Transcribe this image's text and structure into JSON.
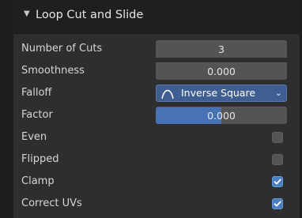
{
  "panel": {
    "title": "Loop Cut and Slide",
    "collapse_arrow": "▼"
  },
  "fields": {
    "number_of_cuts": {
      "label": "Number of Cuts",
      "value": "3"
    },
    "smoothness": {
      "label": "Smoothness",
      "value": "0.000"
    },
    "falloff": {
      "label": "Falloff",
      "value": "Inverse Square",
      "icon": "inverse-square-curve-icon",
      "chevron": "⌄"
    },
    "factor": {
      "label": "Factor",
      "value": "0.000",
      "slider_fraction": 0.5
    },
    "even": {
      "label": "Even",
      "checked": false
    },
    "flipped": {
      "label": "Flipped",
      "checked": false
    },
    "clamp": {
      "label": "Clamp",
      "checked": true
    },
    "correct_uvs": {
      "label": "Correct UVs",
      "checked": true
    }
  },
  "colors": {
    "accent": "#4772b3",
    "dropdown_bg": "#3f5e91",
    "checkbox_checked": "#4a7ec0"
  }
}
